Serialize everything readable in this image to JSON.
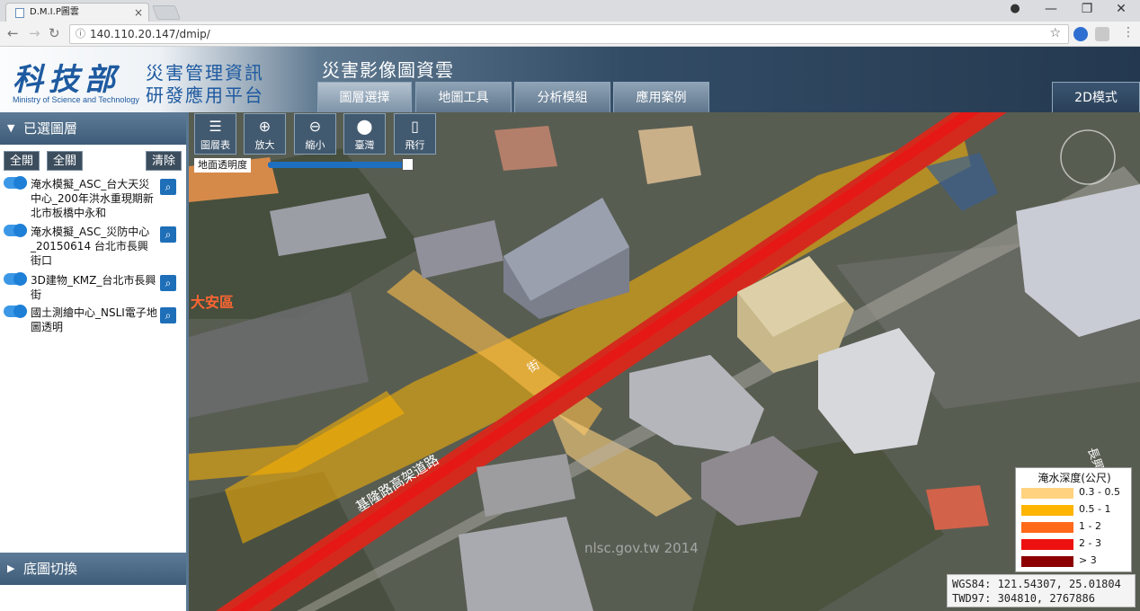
{
  "browser": {
    "tab_title": "D.M.I.P圖雲",
    "tab_close": "×",
    "url": "140.110.20.147/dmip/",
    "window_controls": [
      "—",
      "❐",
      "✕"
    ]
  },
  "header": {
    "logo_text": "科技部",
    "logo_en": "Ministry of Science and Technology",
    "logo_line1": "災害管理資訊",
    "logo_line2": "研發應用平台",
    "app_title": "災害影像圖資雲",
    "tabs": [
      "圖層選擇",
      "地圖工具",
      "分析模組",
      "應用案例"
    ],
    "mode_button": "2D模式"
  },
  "sidebar": {
    "selected_layers_title": "已選圖層",
    "buttons": {
      "open_all": "全開",
      "close_all": "全關",
      "clear": "清除"
    },
    "layers": [
      {
        "label": "淹水模擬_ASC_台大天災中心_200年洪水重現期新北市板橋中永和",
        "on": true
      },
      {
        "label": "淹水模擬_ASC_災防中心_20150614 台北市長興街口",
        "on": true
      },
      {
        "label": "3D建物_KMZ_台北市長興街",
        "on": true
      },
      {
        "label": "國土測繪中心_NSLI電子地圖透明",
        "on": true
      }
    ],
    "basemap_title": "底圖切換"
  },
  "map": {
    "tools": [
      {
        "label": "圖層表",
        "icon": "layers-icon",
        "glyph": "☰"
      },
      {
        "label": "放大",
        "icon": "zoom-in-icon",
        "glyph": "⊕"
      },
      {
        "label": "縮小",
        "icon": "zoom-out-icon",
        "glyph": "⊖"
      },
      {
        "label": "臺灣",
        "icon": "map-pin-icon",
        "glyph": "⬤"
      },
      {
        "label": "飛行",
        "icon": "mouse-icon",
        "glyph": "▯"
      }
    ],
    "opacity_label": "地面透明度",
    "opacity_value": 1.0,
    "place_labels": [
      "大安區",
      "基隆路高架道路",
      "長興",
      "街"
    ],
    "watermark": "nlsc.gov.tw 2014",
    "legend": {
      "title": "淹水深度(公尺)",
      "items": [
        {
          "label": "0.3 - 0.5",
          "color": "#ffd27f"
        },
        {
          "label": "0.5 - 1",
          "color": "#ffb400"
        },
        {
          "label": "1 - 2",
          "color": "#ff6a1a"
        },
        {
          "label": "2 - 3",
          "color": "#ee1111"
        },
        {
          "label": "> 3",
          "color": "#8c0000"
        }
      ]
    },
    "coords": {
      "wgs84": "WGS84: 121.54307, 25.01804",
      "twd97": "TWD97: 304810, 2767886"
    }
  },
  "colors": {
    "accent": "#1e6fc0",
    "header_dark": "#24394f",
    "panel_head": "#4a6884"
  }
}
